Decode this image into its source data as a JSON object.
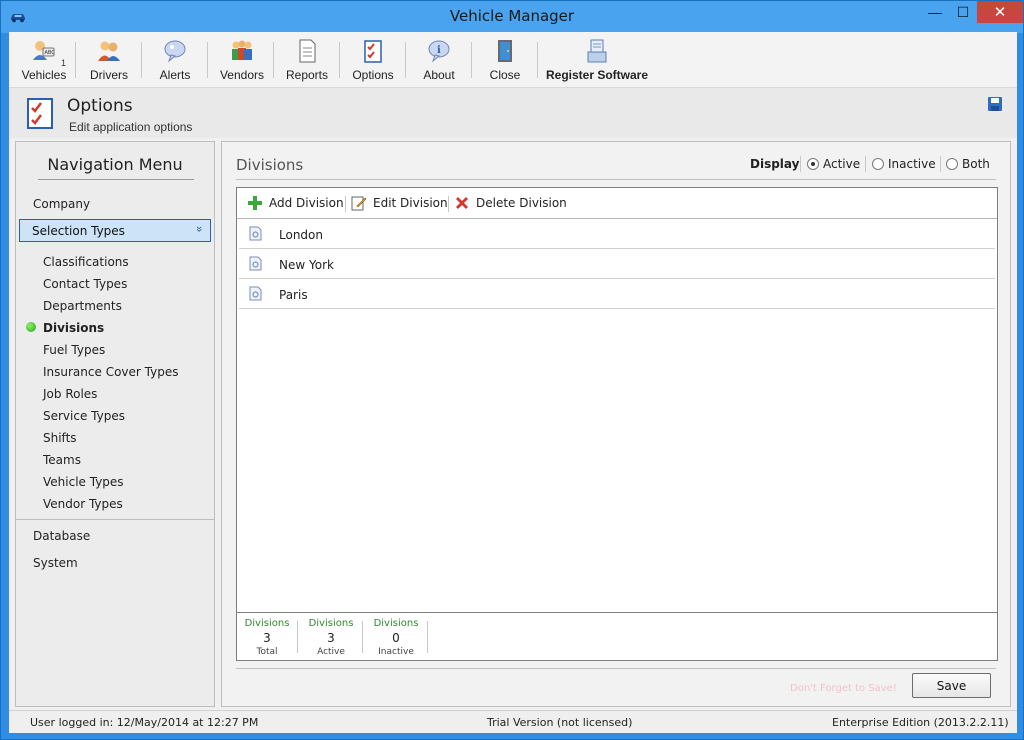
{
  "window": {
    "title": "Vehicle Manager",
    "minimize_glyph": "—",
    "maximize_glyph": "☐",
    "close_glyph": "✕"
  },
  "toolbar": {
    "items": [
      {
        "label": "Vehicles",
        "icon": "vehicles-icon",
        "badge": "1"
      },
      {
        "label": "Drivers",
        "icon": "drivers-icon"
      },
      {
        "label": "Alerts",
        "icon": "alerts-icon"
      },
      {
        "label": "Vendors",
        "icon": "vendors-icon"
      },
      {
        "label": "Reports",
        "icon": "reports-icon"
      },
      {
        "label": "Options",
        "icon": "options-icon"
      },
      {
        "label": "About",
        "icon": "about-icon"
      },
      {
        "label": "Close",
        "icon": "close-door-icon"
      },
      {
        "label": "Register Software",
        "icon": "register-icon"
      }
    ]
  },
  "header": {
    "title": "Options",
    "subtitle": "Edit application options",
    "save_icon": "floppy-save-icon"
  },
  "nav": {
    "title": "Navigation Menu",
    "company": "Company",
    "selected_group": "Selection Types",
    "chevron": "»",
    "sub_items": [
      "Classifications",
      "Contact Types",
      "Departments",
      "Divisions",
      "Fuel Types",
      "Insurance Cover Types",
      "Job Roles",
      "Service Types",
      "Shifts",
      "Teams",
      "Vehicle Types",
      "Vendor Types"
    ],
    "active_sub_item": "Divisions",
    "database": "Database",
    "system": "System"
  },
  "main": {
    "section_title": "Divisions",
    "display_label": "Display",
    "display_options": [
      "Active",
      "Inactive",
      "Both"
    ],
    "display_selected": "Active",
    "actions": {
      "add": "Add Division",
      "edit": "Edit Division",
      "delete": "Delete Division"
    },
    "rows": [
      "London",
      "New York",
      "Paris"
    ],
    "stats": [
      {
        "header": "Divisions",
        "value": "3",
        "footer": "Total"
      },
      {
        "header": "Divisions",
        "value": "3",
        "footer": "Active"
      },
      {
        "header": "Divisions",
        "value": "0",
        "footer": "Inactive"
      }
    ],
    "reminder": "Don't Forget to Save!",
    "save_label": "Save"
  },
  "status": {
    "user": "User logged in:  12/May/2014 at 12:27 PM",
    "version": "Trial Version (not licensed)",
    "edition": "Enterprise Edition (2013.2.2.11)"
  },
  "colors": {
    "titlebar": "#4aa3ee",
    "close_button": "#c7463d",
    "selection": "#cde3f7",
    "stat_header": "#2f8a2f",
    "active_dot": "#2aa31a"
  }
}
